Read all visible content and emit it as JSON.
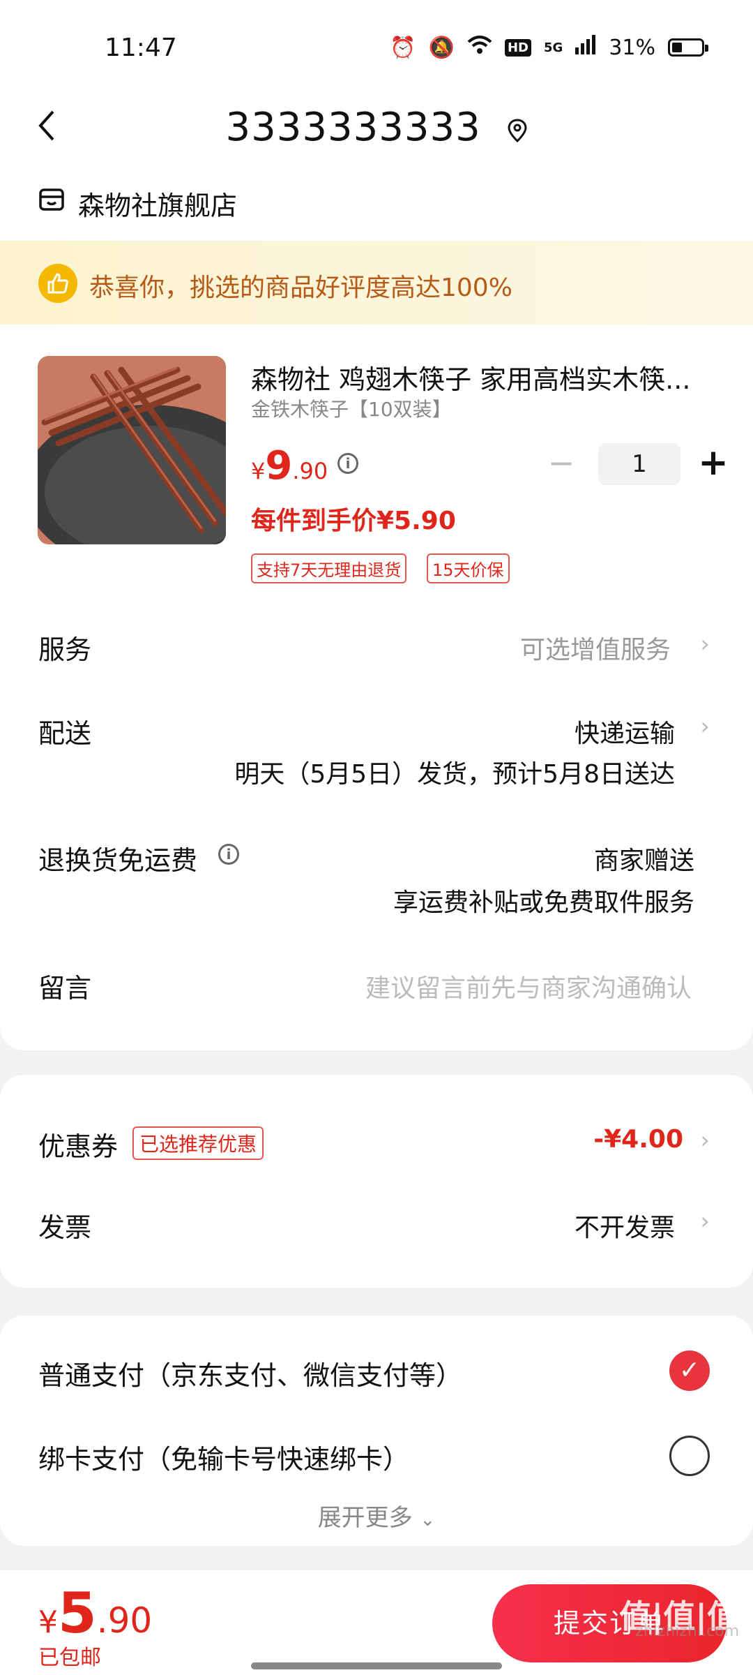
{
  "status_bar": {
    "time": "11:47",
    "network": "5G",
    "battery": "31%",
    "hd": "HD"
  },
  "header": {
    "back_icon": "chevron-left-icon",
    "address": "3333333333",
    "pin_icon": "location-pin-icon"
  },
  "store": {
    "name": "森物社旗舰店",
    "icon": "store-icon"
  },
  "banner": {
    "text": "恭喜你，挑选的商品好评度高达100%",
    "icon": "thumbs-up-icon"
  },
  "product": {
    "title": "森物社 鸡翅木筷子 家用高档实木筷...",
    "spec": "金铁木筷子【10双装】",
    "price_symbol": "¥",
    "price_int": "9",
    "price_dec": ".90",
    "quantity": "1",
    "unit_price": "每件到手价¥5.90",
    "tags": [
      "支持7天无理由退货",
      "15天价保"
    ]
  },
  "rows": {
    "service": {
      "label": "服务",
      "value": "可选增值服务"
    },
    "delivery": {
      "label": "配送",
      "value": "快递运输",
      "detail": "明天（5月5日）发货，预计5月8日送达"
    },
    "return_fee": {
      "label": "退换货免运费",
      "value": "商家赠送",
      "detail": "享运费补贴或免费取件服务"
    },
    "message": {
      "label": "留言",
      "placeholder": "建议留言前先与商家沟通确认"
    }
  },
  "coupon": {
    "label": "优惠券",
    "tag": "已选推荐优惠",
    "value": "-¥4.00"
  },
  "invoice": {
    "label": "发票",
    "value": "不开发票"
  },
  "payment": {
    "option1": "普通支付（京东支付、微信支付等）",
    "option2": "绑卡支付（免输卡号快速绑卡）",
    "more": "展开更多"
  },
  "footer": {
    "price_symbol": "¥",
    "price_int": "5",
    "price_dec": ".90",
    "shipping": "已包邮",
    "submit": "提交订单",
    "watermark_big": "值|值|值",
    "watermark": "zhizhizhi.com"
  },
  "colors": {
    "accent": "#e0261b",
    "banner_text": "#b55a17",
    "banner_bg": "#fdf3cf"
  }
}
